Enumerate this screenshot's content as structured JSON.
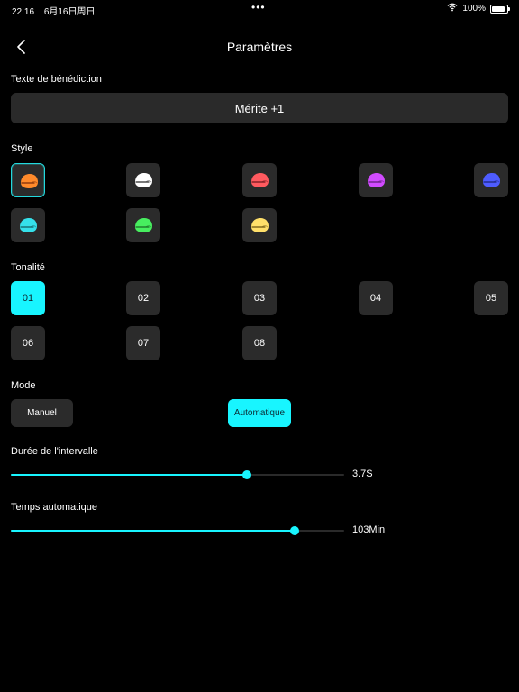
{
  "status_bar": {
    "time": "22:16",
    "date": "6月16日周日",
    "dots": "•••",
    "battery": "100%"
  },
  "nav": {
    "title": "Paramètres"
  },
  "blessing": {
    "label": "Texte de bénédiction",
    "value": "Mérite +1"
  },
  "style": {
    "label": "Style",
    "items": [
      {
        "name": "style-orange",
        "color": "#ff8a2b",
        "selected": true
      },
      {
        "name": "style-white",
        "color": "#ffffff",
        "selected": false
      },
      {
        "name": "style-red",
        "color": "#ff5a5f",
        "selected": false
      },
      {
        "name": "style-purple",
        "color": "#d14bff",
        "selected": false
      },
      {
        "name": "style-blue",
        "color": "#4e5cff",
        "selected": false
      },
      {
        "name": "style-cyan",
        "color": "#35e0ea",
        "selected": false
      },
      {
        "name": "style-green",
        "color": "#47ee5f",
        "selected": false
      },
      {
        "name": "style-yellow",
        "color": "#ffe06a",
        "selected": false
      }
    ]
  },
  "tone": {
    "label": "Tonalité",
    "items": [
      "01",
      "02",
      "03",
      "04",
      "05",
      "06",
      "07",
      "08"
    ],
    "selected": "01"
  },
  "mode": {
    "label": "Mode",
    "manual": "Manuel",
    "auto": "Automatique",
    "selected": "auto"
  },
  "interval": {
    "label": "Durée de l'intervalle",
    "value": "3.7S",
    "fraction": 0.708
  },
  "auto_time": {
    "label": "Temps automatique",
    "value": "103Min",
    "fraction": 0.85
  },
  "colors": {
    "accent": "#18f5ff",
    "tile": "#2b2b2b",
    "track": "#2a2a2a"
  }
}
